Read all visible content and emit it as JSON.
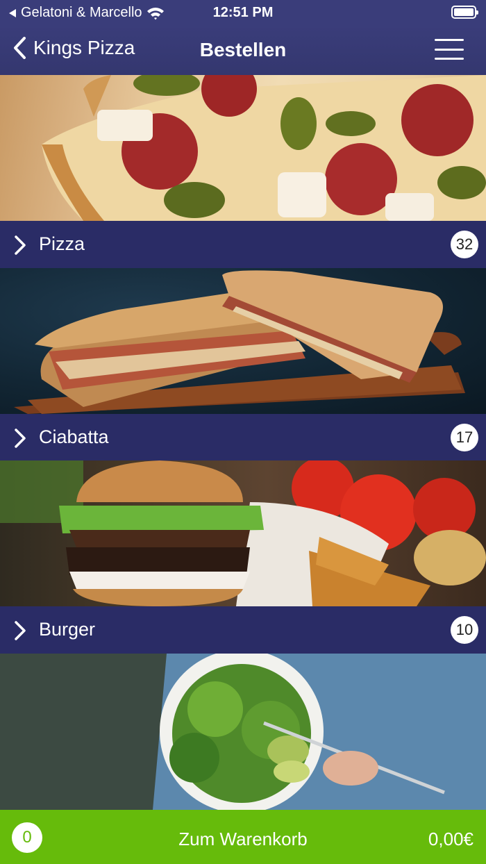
{
  "status_bar": {
    "back_app": "Gelatoni & Marcello",
    "time": "12:51 PM"
  },
  "nav": {
    "back_label": "Kings Pizza",
    "title": "Bestellen"
  },
  "categories": [
    {
      "name": "Pizza",
      "count": "32"
    },
    {
      "name": "Ciabatta",
      "count": "17"
    },
    {
      "name": "Burger",
      "count": "10"
    }
  ],
  "cart": {
    "count": "0",
    "label": "Zum Warenkorb",
    "total": "0,00€"
  },
  "colors": {
    "nav_bg": "#3a3d7a",
    "category_bar_bg": "#2a2c66",
    "cart_bg": "#66bb0b"
  }
}
